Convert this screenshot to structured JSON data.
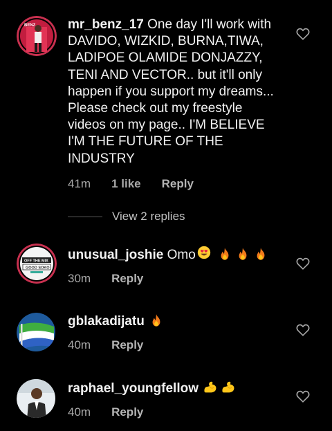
{
  "comments": [
    {
      "username": "mr_benz_17",
      "text": " One day I'll work with DAVIDO, WIZKID, BURNA,TIWA, LADIPOE OLAMIDE DONJAZZY, TENI AND VECTOR.. but it'll only happen if you support my dreams... Please check out my freestyle videos on my page.. I'M BELIEVE I'M THE FUTURE OF THE INDUSTRY",
      "time": "41m",
      "likes": "1 like",
      "reply": "Reply",
      "avatar_text": "BENZ"
    },
    {
      "username": "unusual_joshie",
      "text": " Omo",
      "emojis": [
        "heart-eyes",
        "fire",
        "fire",
        "fire"
      ],
      "time": "30m",
      "reply": "Reply",
      "avatar_text": [
        "OFF THE MIX",
        "GOOD SOKO"
      ]
    },
    {
      "username": "gblakadijatu",
      "text": " ",
      "emojis": [
        "fire"
      ],
      "time": "40m",
      "reply": "Reply"
    },
    {
      "username": "raphael_youngfellow",
      "text": " ",
      "emojis": [
        "flexed-biceps",
        "flexed-biceps"
      ],
      "time": "40m",
      "reply": "Reply"
    }
  ],
  "view_replies": "View 2 replies",
  "colors": {
    "background": "#000000",
    "text": "#f2f2f2",
    "meta": "#a8a8a8",
    "story_ring": "#d8315b"
  }
}
